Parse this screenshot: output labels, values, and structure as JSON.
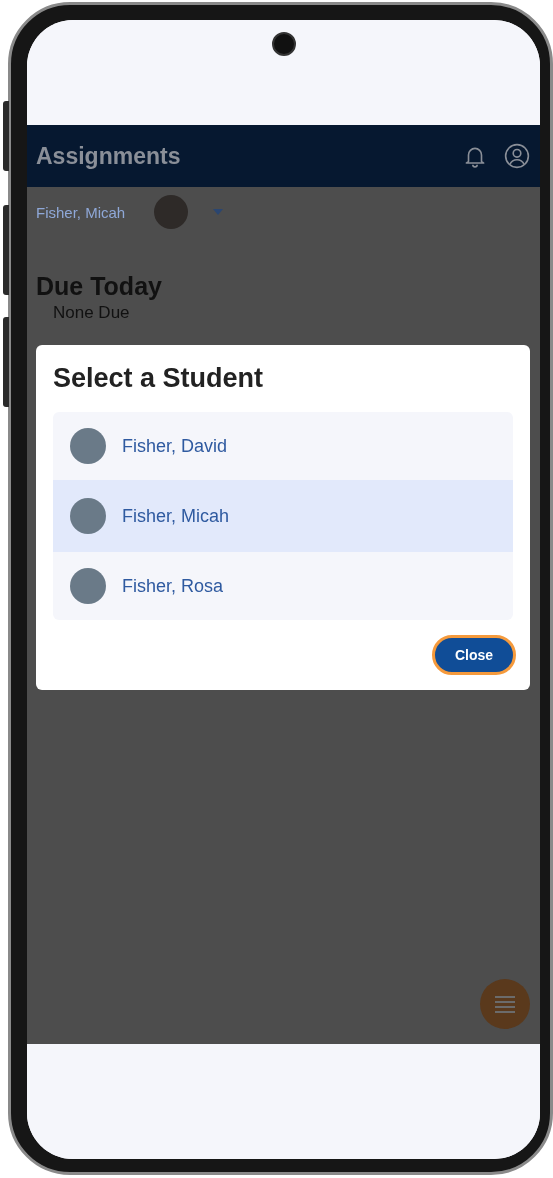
{
  "app_bar": {
    "title": "Assignments"
  },
  "student_picker": {
    "name": "Fisher, Micah"
  },
  "due_today": {
    "heading": "Due Today",
    "message": "None Due"
  },
  "dialog": {
    "title": "Select a Student",
    "students": [
      {
        "name": "Fisher, David",
        "selected": false
      },
      {
        "name": "Fisher, Micah",
        "selected": true
      },
      {
        "name": "Fisher, Rosa",
        "selected": false
      }
    ],
    "close_button": "Close"
  }
}
